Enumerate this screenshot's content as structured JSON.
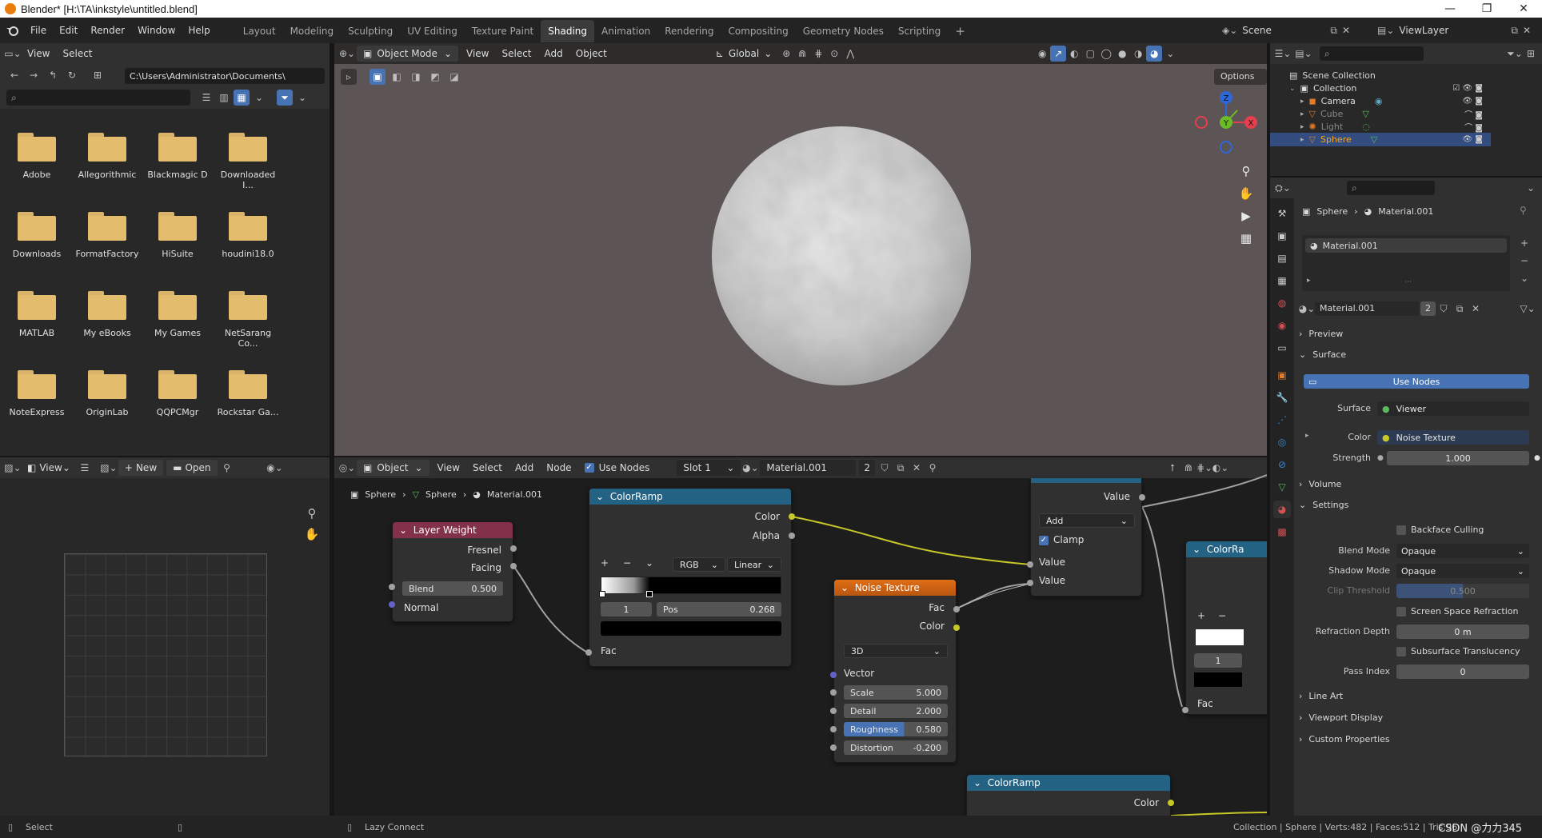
{
  "window": {
    "title": "Blender* [H:\\TA\\inkstyle\\untitled.blend]",
    "minimize": "—",
    "maximize": "❐",
    "close": "✕"
  },
  "menu": [
    "File",
    "Edit",
    "Render",
    "Window",
    "Help"
  ],
  "workspaces": [
    "Layout",
    "Modeling",
    "Sculpting",
    "UV Editing",
    "Texture Paint",
    "Shading",
    "Animation",
    "Rendering",
    "Compositing",
    "Geometry Nodes",
    "Scripting"
  ],
  "active_workspace": "Shading",
  "scene": {
    "name": "Scene",
    "view_layer": "ViewLayer"
  },
  "file_browser": {
    "menu": [
      "View",
      "Select"
    ],
    "path": "C:\\Users\\Administrator\\Documents\\",
    "folders": [
      "Adobe",
      "Allegorithmic",
      "Blackmagic D",
      "Downloaded I...",
      "Downloads",
      "FormatFactory",
      "HiSuite",
      "houdini18.0",
      "MATLAB",
      "My eBooks",
      "My Games",
      "NetSarang Co...",
      "NoteExpress",
      "OriginLab",
      "QQPCMgr",
      "Rockstar Ga..."
    ]
  },
  "viewport": {
    "mode": "Object Mode",
    "menu": [
      "View",
      "Select",
      "Add",
      "Object"
    ],
    "transform": "Global",
    "options": "Options",
    "gizmo": {
      "z": "Z",
      "y": "Y",
      "x": "X"
    }
  },
  "image_editor": {
    "view": "View",
    "new": "New",
    "open": "Open"
  },
  "node_editor": {
    "type": "Object",
    "menu": [
      "View",
      "Select",
      "Add",
      "Node"
    ],
    "use_nodes": "Use Nodes",
    "slot": "Slot 1",
    "material": "Material.001",
    "users": "2",
    "breadcrumb": [
      "Sphere",
      "Sphere",
      "Material.001"
    ]
  },
  "nodes": {
    "layer_weight": {
      "title": "Layer Weight",
      "fresnel": "Fresnel",
      "facing": "Facing",
      "blend_label": "Blend",
      "blend_value": "0.500",
      "normal": "Normal"
    },
    "colorramp1": {
      "title": "ColorRamp",
      "color": "Color",
      "alpha": "Alpha",
      "plus": "+",
      "minus": "−",
      "chevron": "⌄",
      "mode": "RGB",
      "interp": "Linear",
      "index": "1",
      "pos_label": "Pos",
      "pos_value": "0.268",
      "fac": "Fac"
    },
    "noise": {
      "title": "Noise Texture",
      "fac": "Fac",
      "color": "Color",
      "dims": "3D",
      "vector": "Vector",
      "scale_label": "Scale",
      "scale_value": "5.000",
      "detail_label": "Detail",
      "detail_value": "2.000",
      "rough_label": "Roughness",
      "rough_value": "0.580",
      "distortion_label": "Distortion",
      "distortion_value": "-0.200"
    },
    "math": {
      "value_out": "Value",
      "op": "Add",
      "clamp": "Clamp",
      "value_in1": "Value",
      "value_in2": "Value"
    },
    "colorramp2": {
      "title": "ColorRa",
      "plus": "+",
      "minus": "−",
      "index": "1",
      "fac": "Fac"
    },
    "colorramp3": {
      "title": "ColorRamp",
      "color": "Color"
    }
  },
  "outliner": {
    "scene_collection": "Scene Collection",
    "items": [
      {
        "name": "Collection",
        "indent": 1
      },
      {
        "name": "Camera",
        "indent": 2
      },
      {
        "name": "Cube",
        "indent": 2
      },
      {
        "name": "Light",
        "indent": 2
      },
      {
        "name": "Sphere",
        "indent": 2
      }
    ]
  },
  "properties": {
    "breadcrumb_object": "Sphere",
    "breadcrumb_material": "Material.001",
    "slot_name": "Material.001",
    "material": "Material.001",
    "users": "2",
    "sections": {
      "preview": "Preview",
      "surface": "Surface",
      "volume": "Volume",
      "settings": "Settings",
      "line_art": "Line Art",
      "viewport_display": "Viewport Display",
      "custom_props": "Custom Properties"
    },
    "use_nodes": "Use Nodes",
    "surface_label": "Surface",
    "surface_value": "Viewer",
    "color_label": "Color",
    "color_value": "Noise Texture",
    "strength_label": "Strength",
    "strength_value": "1.000",
    "backface": "Backface Culling",
    "blend_mode_label": "Blend Mode",
    "blend_mode_value": "Opaque",
    "shadow_mode_label": "Shadow Mode",
    "shadow_mode_value": "Opaque",
    "clip_label": "Clip Threshold",
    "clip_value": "0.500",
    "ssr": "Screen Space Refraction",
    "refr_label": "Refraction Depth",
    "refr_value": "0 m",
    "sss": "Subsurface Translucency",
    "pass_label": "Pass Index",
    "pass_value": "0"
  },
  "status": {
    "left": "Select",
    "middle": "Lazy Connect",
    "right": "Collection | Sphere | Verts:482 | Faces:512 | Tris:96",
    "watermark": "CSDN @力力345"
  },
  "colors": {
    "accent": "#4772b3",
    "header_node_input": "#83314a",
    "header_node_converter": "#246283",
    "header_node_texture": "#e06e16",
    "socket_grey": "#a1a1a1",
    "socket_yellow": "#c7c729",
    "socket_purple": "#6363c7"
  }
}
